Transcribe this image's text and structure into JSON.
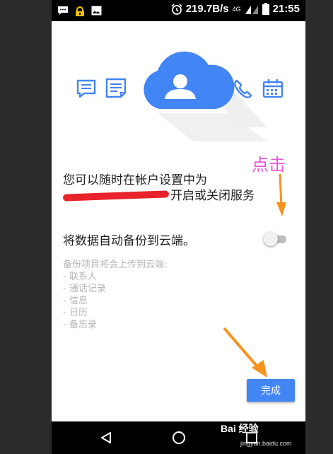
{
  "statusbar": {
    "speed": "219.7B/s",
    "network": "4G",
    "time": "21:55",
    "icons": [
      "chat-icon",
      "wifi-lock-icon",
      "image-icon",
      "alarm-icon",
      "signal-icon",
      "battery-icon"
    ]
  },
  "hero": {
    "icons": [
      "message-icon",
      "note-icon",
      "cloud-contact-icon",
      "phone-icon",
      "calendar-icon"
    ],
    "accent_color": "#4285f4"
  },
  "message": {
    "line1": "您可以随时在帐户设置中为",
    "line2_suffix": "开启或关闭服务"
  },
  "backup_toggle": {
    "label": "将数据自动备份到云端。",
    "enabled": false
  },
  "backup_items": {
    "title": "备份项目将会上传到云端:",
    "items": [
      "- 联系人",
      "- 通话记录",
      "- 信息",
      "- 日历",
      "- 备忘录"
    ]
  },
  "done_button": {
    "label": "完成"
  },
  "annotation": {
    "text": "点击",
    "color": "#e65ad7"
  },
  "navbar": {
    "icons": [
      "back-icon",
      "home-icon",
      "recents-icon"
    ]
  },
  "watermark": {
    "brand": "Bai 经验",
    "url": "jingyan.baidu.com"
  }
}
